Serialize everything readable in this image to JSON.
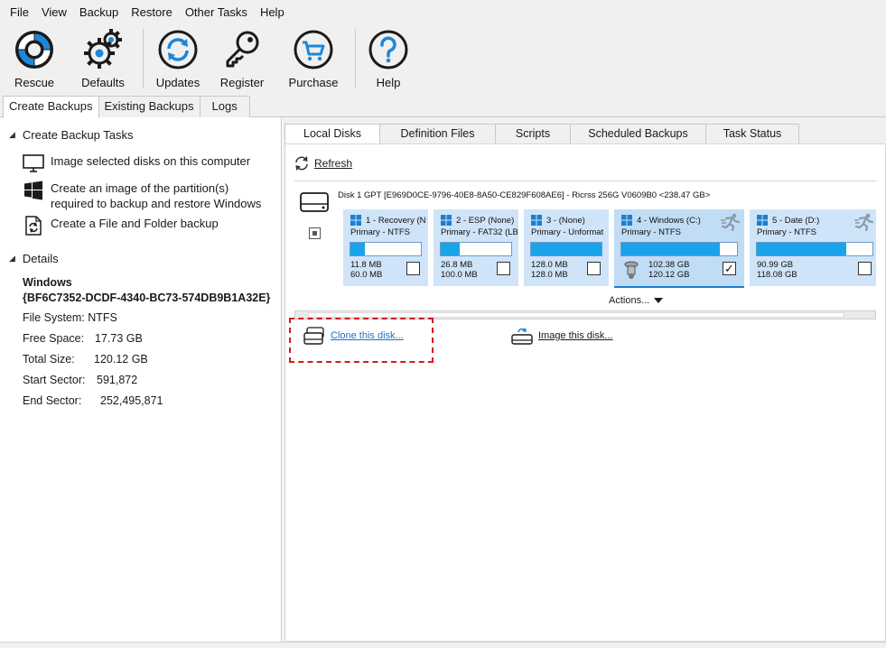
{
  "menu": [
    "File",
    "View",
    "Backup",
    "Restore",
    "Other Tasks",
    "Help"
  ],
  "toolbar": {
    "rescue": "Rescue",
    "defaults": "Defaults",
    "updates": "Updates",
    "register": "Register",
    "purchase": "Purchase",
    "help": "Help"
  },
  "outer_tabs": [
    "Create Backups",
    "Existing Backups",
    "Logs"
  ],
  "left": {
    "tasks_header": "Create Backup Tasks",
    "tasks": [
      {
        "line1": "Image selected disks on this computer",
        "line2": ""
      },
      {
        "line1": "Create an image of the partition(s)",
        "line2": "required to backup and restore Windows"
      },
      {
        "line1": "Create a File and Folder backup",
        "line2": ""
      }
    ],
    "details_header": "Details",
    "details": {
      "name": "Windows",
      "guid": "{BF6C7352-DCDF-4340-BC73-574DB9B1A32E}",
      "file_system": "File System: NTFS",
      "free_label": "Free Space:",
      "free_value": "17.73 GB",
      "total_label": "Total Size:",
      "total_value": "120.12 GB",
      "start_label": "Start Sector:",
      "start_value": "591,872",
      "end_label": "End Sector:",
      "end_value": "252,495,871"
    }
  },
  "inner_tabs": [
    "Local Disks",
    "Definition Files",
    "Scripts",
    "Scheduled Backups",
    "Task Status"
  ],
  "refresh": "Refresh",
  "disk": {
    "title": "Disk 1 GPT [E969D0CE-9796-40E8-8A50-CE829F608AE6] - Ricrss 256G V0609B0  <238.47 GB>",
    "partitions": [
      {
        "name": "1 - Recovery (N",
        "type": "Primary - NTFS",
        "used": "11.8 MB",
        "total": "60.0 MB",
        "fill": 0.2,
        "checked": false
      },
      {
        "name": "2 - ESP (None)",
        "type": "Primary - FAT32 (LB",
        "used": "26.8 MB",
        "total": "100.0 MB",
        "fill": 0.27,
        "checked": false
      },
      {
        "name": "3 -  (None)",
        "type": "Primary - Unformat",
        "used": "128.0 MB",
        "total": "128.0 MB",
        "fill": 1.0,
        "checked": false
      },
      {
        "name": "4 - Windows (C:)",
        "type": "Primary - NTFS",
        "used": "102.38 GB",
        "total": "120.12 GB",
        "fill": 0.85,
        "checked": true
      },
      {
        "name": "5 - Date (D:)",
        "type": "Primary - NTFS",
        "used": "90.99 GB",
        "total": "118.08 GB",
        "fill": 0.77,
        "checked": false
      }
    ],
    "actions": "Actions...",
    "checked_mark": "✓"
  },
  "clone_link": "Clone this disk...",
  "image_link": "Image this disk..."
}
